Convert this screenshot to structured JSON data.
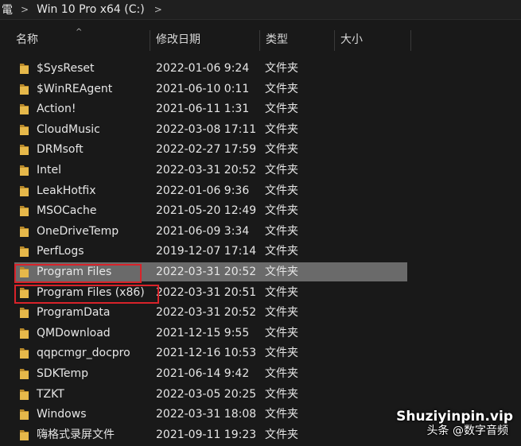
{
  "breadcrumb": {
    "prev": "電",
    "current": "Win 10 Pro x64 (C:)",
    "sep_glyph": ">"
  },
  "columns": {
    "name": "名称",
    "modified": "修改日期",
    "type": "类型",
    "size": "大小"
  },
  "sort_indicator": "^",
  "rows": [
    {
      "name": "$SysReset",
      "date": "2022-01-06 9:24",
      "type": "文件夹"
    },
    {
      "name": "$WinREAgent",
      "date": "2021-06-10 0:11",
      "type": "文件夹"
    },
    {
      "name": "Action!",
      "date": "2021-06-11 1:31",
      "type": "文件夹"
    },
    {
      "name": "CloudMusic",
      "date": "2022-03-08 17:11",
      "type": "文件夹"
    },
    {
      "name": "DRMsoft",
      "date": "2022-02-27 17:59",
      "type": "文件夹"
    },
    {
      "name": "Intel",
      "date": "2022-03-31 20:52",
      "type": "文件夹"
    },
    {
      "name": "LeakHotfix",
      "date": "2022-01-06 9:36",
      "type": "文件夹"
    },
    {
      "name": "MSOCache",
      "date": "2021-05-20 12:49",
      "type": "文件夹"
    },
    {
      "name": "OneDriveTemp",
      "date": "2021-06-09 3:34",
      "type": "文件夹"
    },
    {
      "name": "PerfLogs",
      "date": "2019-12-07 17:14",
      "type": "文件夹"
    },
    {
      "name": "Program Files",
      "date": "2022-03-31 20:52",
      "type": "文件夹",
      "selected": true
    },
    {
      "name": "Program Files (x86)",
      "date": "2022-03-31 20:51",
      "type": "文件夹"
    },
    {
      "name": "ProgramData",
      "date": "2022-03-31 20:52",
      "type": "文件夹"
    },
    {
      "name": "QMDownload",
      "date": "2021-12-15 9:55",
      "type": "文件夹"
    },
    {
      "name": "qqpcmgr_docpro",
      "date": "2021-12-16 10:53",
      "type": "文件夹"
    },
    {
      "name": "SDKTemp",
      "date": "2021-06-14 9:42",
      "type": "文件夹"
    },
    {
      "name": "TZKT",
      "date": "2022-03-05 20:25",
      "type": "文件夹"
    },
    {
      "name": "Windows",
      "date": "2022-03-31 18:08",
      "type": "文件夹"
    },
    {
      "name": "嗨格式录屏文件",
      "date": "2021-09-11 19:23",
      "type": "文件夹"
    }
  ],
  "watermark": {
    "line1": "Shuziyinpin.vip",
    "line2": "头条 @数字音频"
  },
  "colors": {
    "background": "#191919",
    "selected_row": "#6a6a6a",
    "folder_yellow": "#e6b84a",
    "highlight_box": "#d8232a"
  },
  "icons": {
    "folder": "folder-icon",
    "separator": "chevron-right-icon",
    "sort": "sort-ascending-icon"
  }
}
